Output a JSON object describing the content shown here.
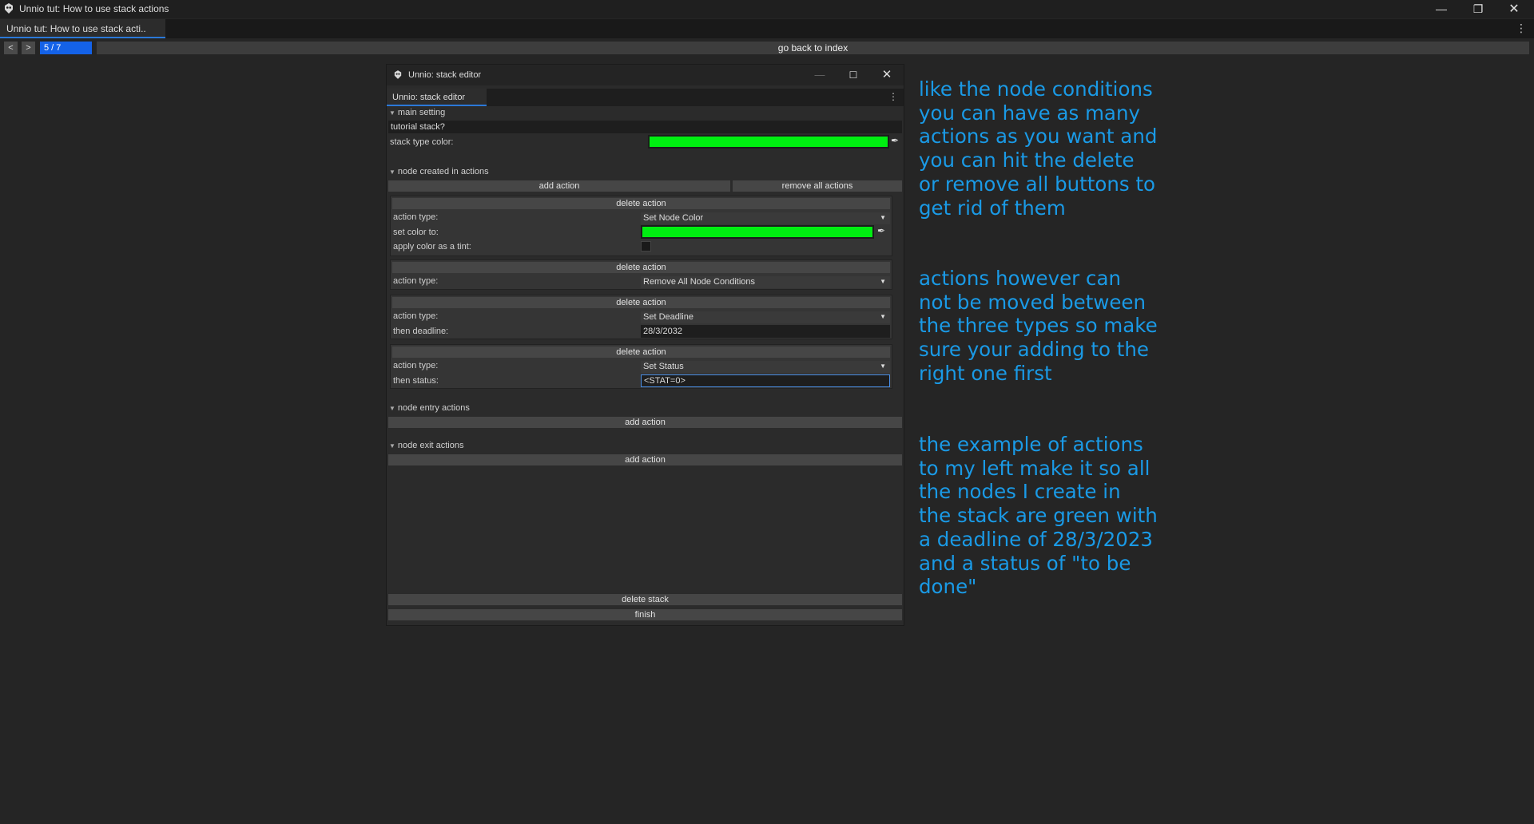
{
  "window": {
    "title": "Unnio tut: How to use stack actions",
    "controls": [
      "minimize-icon",
      "restore-icon",
      "close-icon"
    ]
  },
  "tabbar": {
    "tab_label": "Unnio tut: How to use stack acti.."
  },
  "nav": {
    "prev_label": "<",
    "next_label": ">",
    "page_indicator": "5 / 7",
    "back_label": "go back to index"
  },
  "editor": {
    "title": "Unnio: stack editor",
    "tab_label": "Unnio: stack editor",
    "main_setting": {
      "header": "main setting",
      "stack_name": "tutorial stack?",
      "color_label": "stack type color:",
      "color": "#00ee11"
    },
    "created": {
      "header": "node created in actions",
      "add_label": "add action",
      "remove_all_label": "remove all actions",
      "actions": [
        {
          "delete_label": "delete action",
          "type_label": "action type:",
          "type_value": "Set Node Color",
          "set_color_label": "set color to:",
          "set_color": "#00ee11",
          "tint_label": "apply color as a tint:",
          "tint_checked": false
        },
        {
          "delete_label": "delete action",
          "type_label": "action type:",
          "type_value": "Remove All Node Conditions"
        },
        {
          "delete_label": "delete action",
          "type_label": "action type:",
          "type_value": "Set Deadline",
          "deadline_label": "then deadline:",
          "deadline_value": "28/3/2032"
        },
        {
          "delete_label": "delete action",
          "type_label": "action type:",
          "type_value": "Set Status",
          "status_label": "then status:",
          "status_value": "<STAT=0>"
        }
      ]
    },
    "entry": {
      "header": "node entry actions",
      "add_label": "add action"
    },
    "exit": {
      "header": "node exit actions",
      "add_label": "add action"
    },
    "delete_stack_label": "delete stack",
    "finish_label": "finish"
  },
  "notes": [
    "like the node conditions you can have as many actions as you want and you can hit the delete or remove all buttons to get rid of them",
    "actions however can not be moved between the three types so make sure your adding to the right one first",
    "the example of actions to my left make it so all the nodes I create in the stack are green with a deadline of 28/3/2023 and a status of \"to be done\""
  ]
}
